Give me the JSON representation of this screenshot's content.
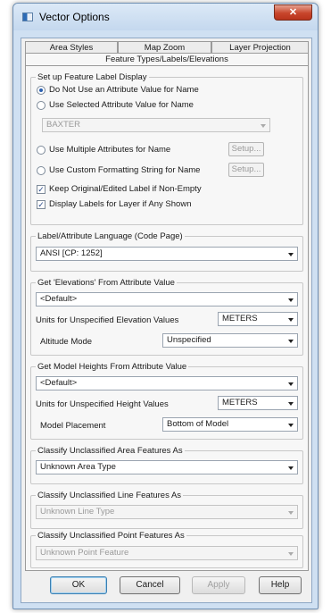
{
  "window": {
    "title": "Vector Options",
    "close_glyph": "✕",
    "icon": "app-icon"
  },
  "tabs": {
    "row1": [
      "Area Styles",
      "Map Zoom",
      "Layer Projection"
    ],
    "active": "Feature Types/Labels/Elevations"
  },
  "label_display": {
    "group_title": "Set up Feature Label Display",
    "options": [
      {
        "label": "Do Not Use an Attribute Value for Name",
        "checked": true
      },
      {
        "label": "Use Selected Attribute Value for Name",
        "checked": false
      },
      {
        "label": "Use Multiple Attributes for Name",
        "checked": false
      },
      {
        "label": "Use Custom Formatting String for Name",
        "checked": false
      }
    ],
    "attribute_value": "BAXTER",
    "setup_label": "Setup...",
    "keep_original_label": "Keep Original/Edited Label if Non-Empty",
    "keep_original_checked": true,
    "display_labels_label": "Display Labels for Layer if Any Shown",
    "display_labels_checked": true
  },
  "language": {
    "group_title": "Label/Attribute Language (Code Page)",
    "value": "ANSI [CP: 1252]"
  },
  "elevations": {
    "group_title": "Get 'Elevations' From Attribute Value",
    "attribute": "<Default>",
    "units_label": "Units for Unspecified Elevation Values",
    "units_value": "METERS",
    "altitude_label": "Altitude Mode",
    "altitude_value": "Unspecified"
  },
  "heights": {
    "group_title": "Get Model Heights From Attribute Value",
    "attribute": "<Default>",
    "units_label": "Units for Unspecified Height Values",
    "units_value": "METERS",
    "placement_label": "Model Placement",
    "placement_value": "Bottom of Model"
  },
  "classify_area": {
    "group_title": "Classify Unclassified Area Features As",
    "value": "Unknown Area Type"
  },
  "classify_line": {
    "group_title": "Classify Unclassified Line Features As",
    "value": "Unknown Line Type"
  },
  "classify_point": {
    "group_title": "Classify Unclassified Point Features As",
    "value": "Unknown Point Feature"
  },
  "buttons": {
    "ok": "OK",
    "cancel": "Cancel",
    "apply": "Apply",
    "help": "Help"
  },
  "check_glyph": "✓",
  "colors": {
    "title_bar": "#c4d8ee",
    "close_button": "#c8452b",
    "dialog_bg": "#f0f0f0"
  }
}
